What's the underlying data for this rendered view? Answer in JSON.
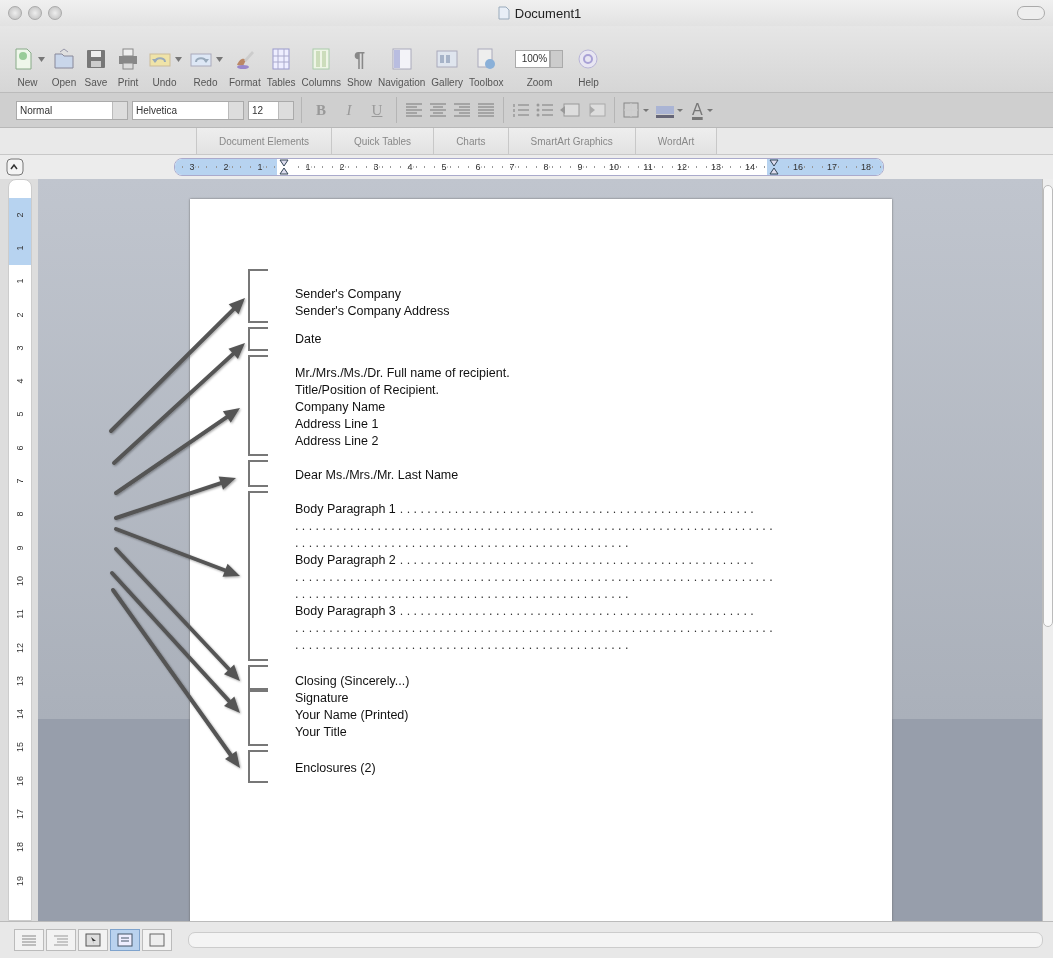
{
  "window": {
    "title": "Document1"
  },
  "standard_toolbar": [
    {
      "label": "New",
      "menu": true
    },
    {
      "label": "Open",
      "menu": false
    },
    {
      "label": "Save",
      "menu": false
    },
    {
      "label": "Print",
      "menu": false
    },
    {
      "label": "Undo",
      "menu": true
    },
    {
      "label": "Redo",
      "menu": true
    },
    {
      "label": "Format",
      "menu": false
    },
    {
      "label": "Tables",
      "menu": false
    },
    {
      "label": "Columns",
      "menu": false
    },
    {
      "label": "Show",
      "glyph": "¶",
      "menu": false
    },
    {
      "label": "Navigation",
      "menu": false
    },
    {
      "label": "Gallery",
      "menu": false
    },
    {
      "label": "Toolbox",
      "menu": false
    },
    {
      "label": "Zoom",
      "value": "100%",
      "menu": true
    },
    {
      "label": "Help",
      "menu": false
    }
  ],
  "formatting_toolbar": {
    "style": "Normal",
    "font": "Helvetica",
    "size": "12",
    "text_buttons": [
      "B",
      "I",
      "U"
    ],
    "font_color_glyph": "A"
  },
  "gallery_tabs": [
    {
      "label": "Document Elements"
    },
    {
      "label": "Quick Tables"
    },
    {
      "label": "Charts"
    },
    {
      "label": "SmartArt Graphics"
    },
    {
      "label": "WordArt"
    }
  ],
  "horizontal_ruler": [
    {
      "label": "3",
      "margin": true
    },
    {
      "label": "2",
      "margin": true
    },
    {
      "label": "1",
      "margin": true
    },
    {
      "kind": "indent",
      "margin": false
    },
    {
      "label": "1",
      "margin": false
    },
    {
      "label": "2",
      "margin": false
    },
    {
      "label": "3",
      "margin": false
    },
    {
      "label": "4",
      "margin": false
    },
    {
      "label": "5",
      "margin": false
    },
    {
      "label": "6",
      "margin": false
    },
    {
      "label": "7",
      "margin": false
    },
    {
      "label": "8",
      "margin": false
    },
    {
      "label": "9",
      "margin": false
    },
    {
      "label": "10",
      "margin": false
    },
    {
      "label": "11",
      "margin": false
    },
    {
      "label": "12",
      "margin": false
    },
    {
      "label": "13",
      "margin": false
    },
    {
      "label": "14",
      "margin": false
    },
    {
      "kind": "indent",
      "margin": true
    },
    {
      "label": "16",
      "margin": true
    },
    {
      "label": "17",
      "margin": true
    },
    {
      "label": "18",
      "margin": true
    }
  ],
  "vertical_ruler": [
    {
      "label": "2",
      "margin": true
    },
    {
      "label": "1",
      "margin": true
    },
    {
      "label": "1",
      "margin": false
    },
    {
      "label": "2",
      "margin": false
    },
    {
      "label": "3",
      "margin": false
    },
    {
      "label": "4",
      "margin": false
    },
    {
      "label": "5",
      "margin": false
    },
    {
      "label": "6",
      "margin": false
    },
    {
      "label": "7",
      "margin": false
    },
    {
      "label": "8",
      "margin": false
    },
    {
      "label": "9",
      "margin": false
    },
    {
      "label": "10",
      "margin": false
    },
    {
      "label": "11",
      "margin": false
    },
    {
      "label": "12",
      "margin": false
    },
    {
      "label": "13",
      "margin": false
    },
    {
      "label": "14",
      "margin": false
    },
    {
      "label": "15",
      "margin": false
    },
    {
      "label": "16",
      "margin": false
    },
    {
      "label": "17",
      "margin": false
    },
    {
      "label": "18",
      "margin": false
    },
    {
      "label": "19",
      "margin": false
    }
  ],
  "document": {
    "blocks": [
      {
        "lines": [
          "Sender's Company",
          "Sender's Company Address"
        ]
      },
      {
        "lines": [
          "Date"
        ]
      },
      {
        "lines": [
          "Mr./Mrs./Ms./Dr. Full name of recipient.",
          "Title/Position of Recipient.",
          "Company Name",
          "Address Line 1",
          "Address Line 2"
        ]
      },
      {
        "lines": [
          "Dear Ms./Mrs./Mr. Last Name"
        ]
      },
      {
        "paragraphs": [
          {
            "label": "Body Paragraph 1",
            "fill": [
              "....................................................",
              "......................................................................",
              "................................................."
            ]
          },
          {
            "label": "Body Paragraph 2",
            "fill": [
              "....................................................",
              "......................................................................",
              "................................................."
            ]
          },
          {
            "label": "Body Paragraph 3",
            "fill": [
              "....................................................",
              "......................................................................",
              "................................................."
            ]
          }
        ]
      },
      {
        "lines": [
          "Closing (Sincerely...)"
        ]
      },
      {
        "lines": [
          "Signature",
          "Your Name (Printed)",
          "Your Title"
        ]
      },
      {
        "lines": [
          "Enclosures (2)"
        ]
      }
    ]
  },
  "view_buttons": [
    {
      "selected": false
    },
    {
      "selected": false
    },
    {
      "selected": false
    },
    {
      "selected": true
    },
    {
      "selected": false
    }
  ]
}
